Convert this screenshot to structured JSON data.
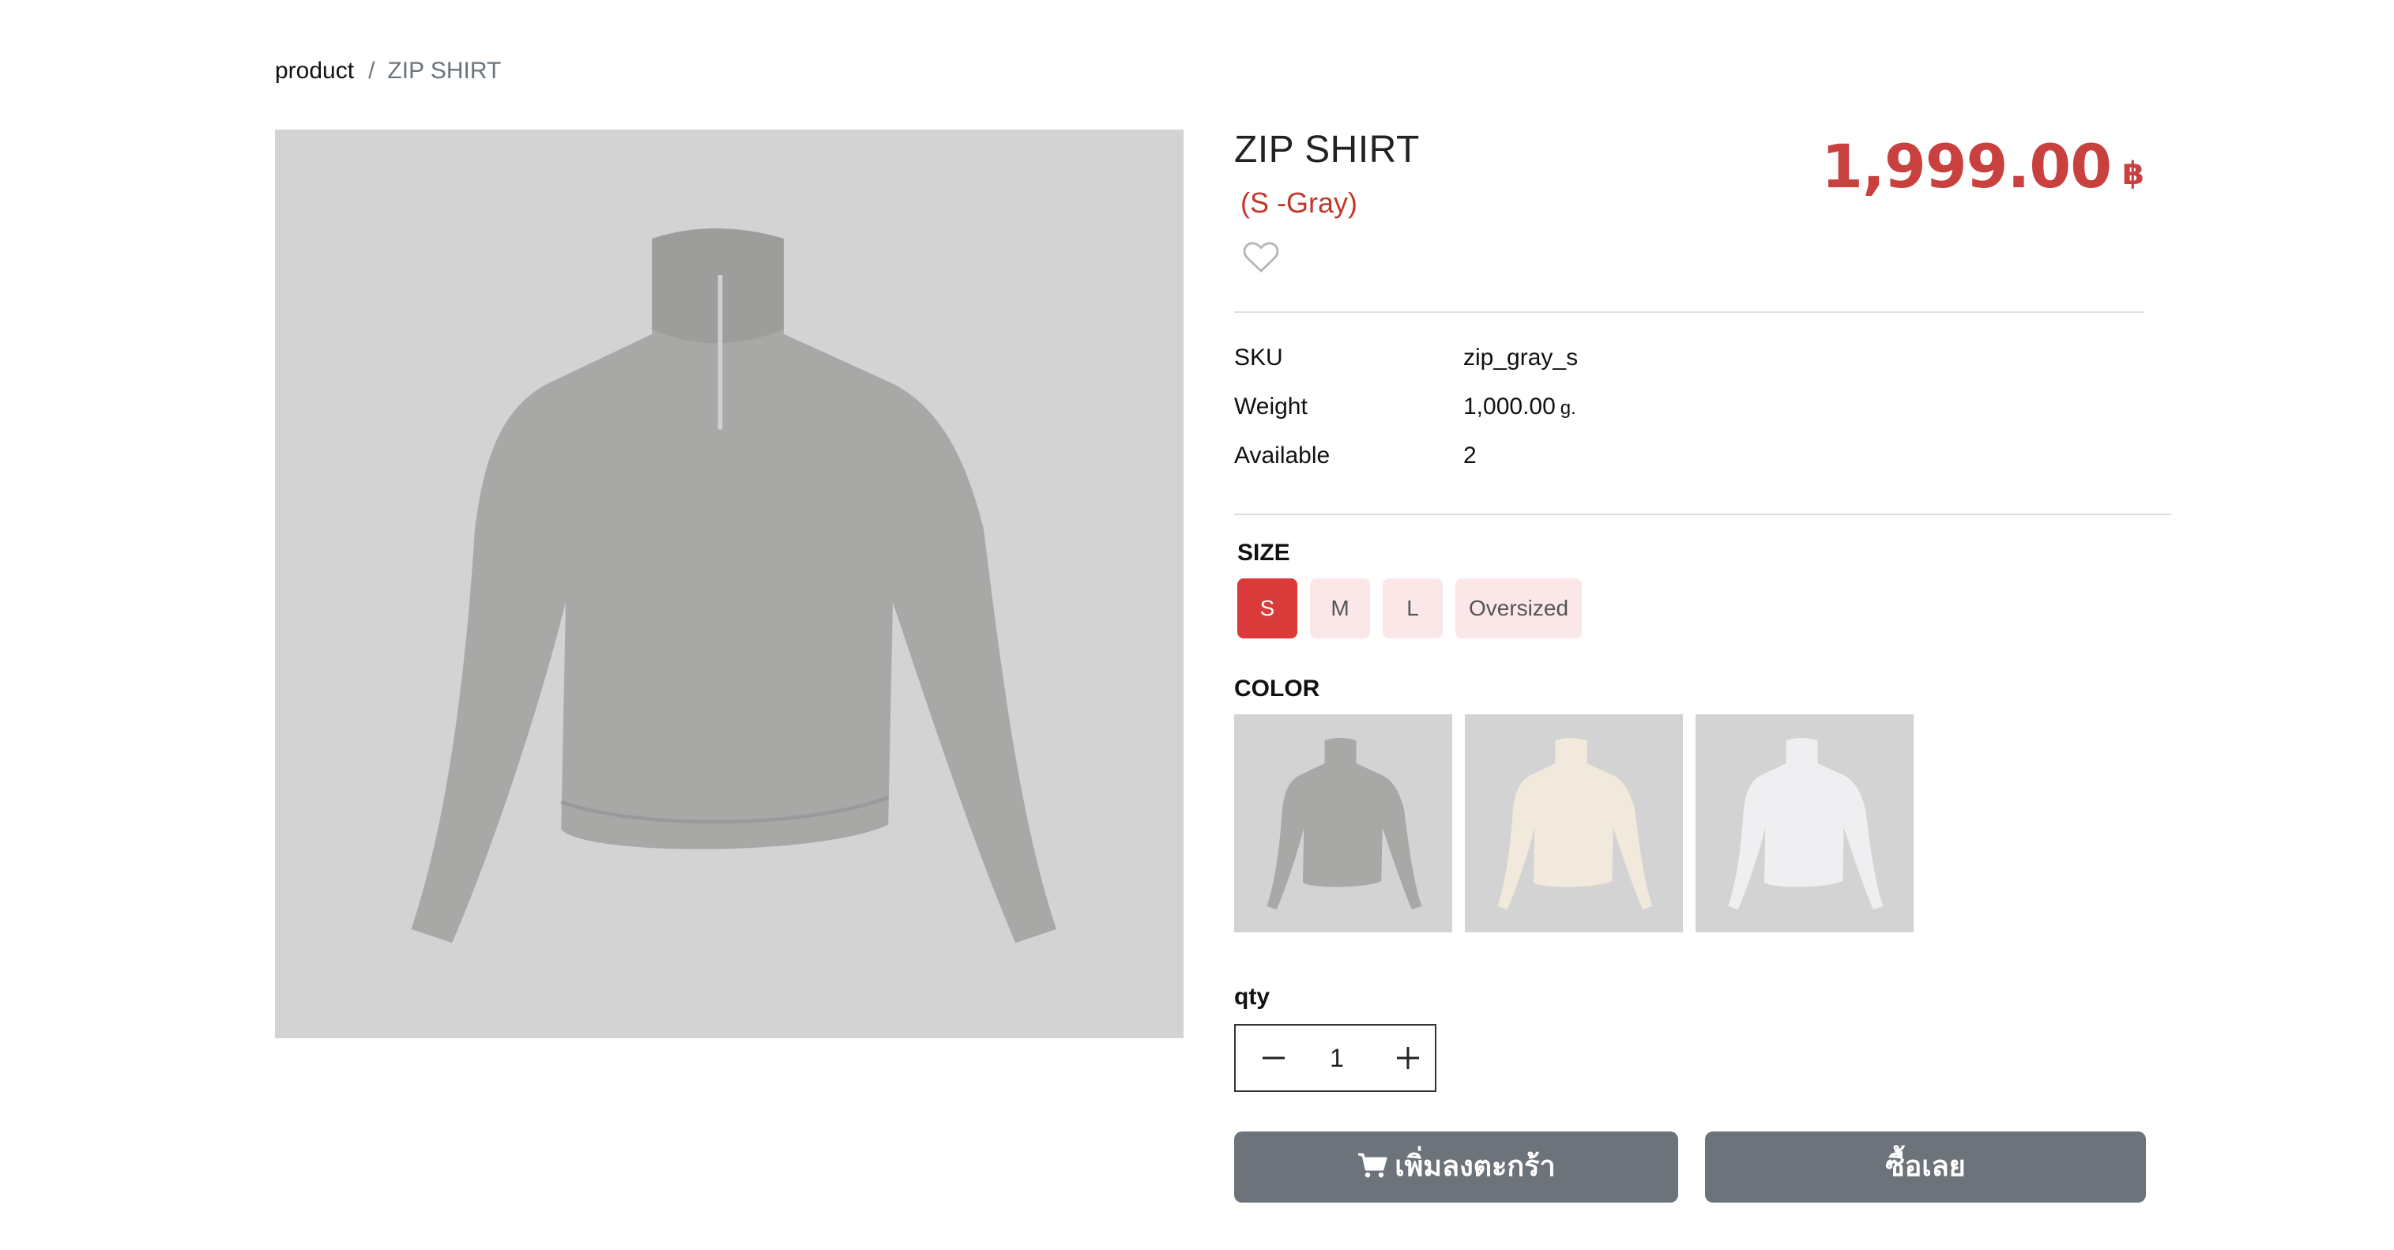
{
  "breadcrumb": {
    "home": "product",
    "separator": "/",
    "current": "ZIP SHIRT"
  },
  "product": {
    "title": "ZIP SHIRT",
    "variant": "(S -Gray)",
    "price": "1,999.00",
    "currency": "฿",
    "favorite_icon": "heart-outline-icon"
  },
  "specs": {
    "sku_label": "SKU",
    "sku_value": "zip_gray_s",
    "weight_label": "Weight",
    "weight_value": "1,000.00",
    "weight_unit": "g.",
    "available_label": "Available",
    "available_value": "2"
  },
  "size": {
    "label": "SIZE",
    "options": [
      "S",
      "M",
      "L",
      "Oversized"
    ],
    "selected": "S"
  },
  "color": {
    "label": "COLOR",
    "options": [
      "Gray",
      "Cream",
      "White"
    ],
    "selected": "Gray"
  },
  "qty": {
    "label": "qty",
    "value": "1",
    "minus_icon": "minus-icon",
    "plus_icon": "plus-icon"
  },
  "actions": {
    "add_to_cart": "เพิ่มลงตะกร้า",
    "add_to_cart_icon": "cart-icon",
    "buy_now": "ซื้อเลย"
  },
  "colors": {
    "accent": "#c9413f",
    "size_active": "#d93a3a",
    "size_inactive": "#fbe7e7",
    "button": "#6c737b",
    "image_bg": "#d3d3d3"
  }
}
